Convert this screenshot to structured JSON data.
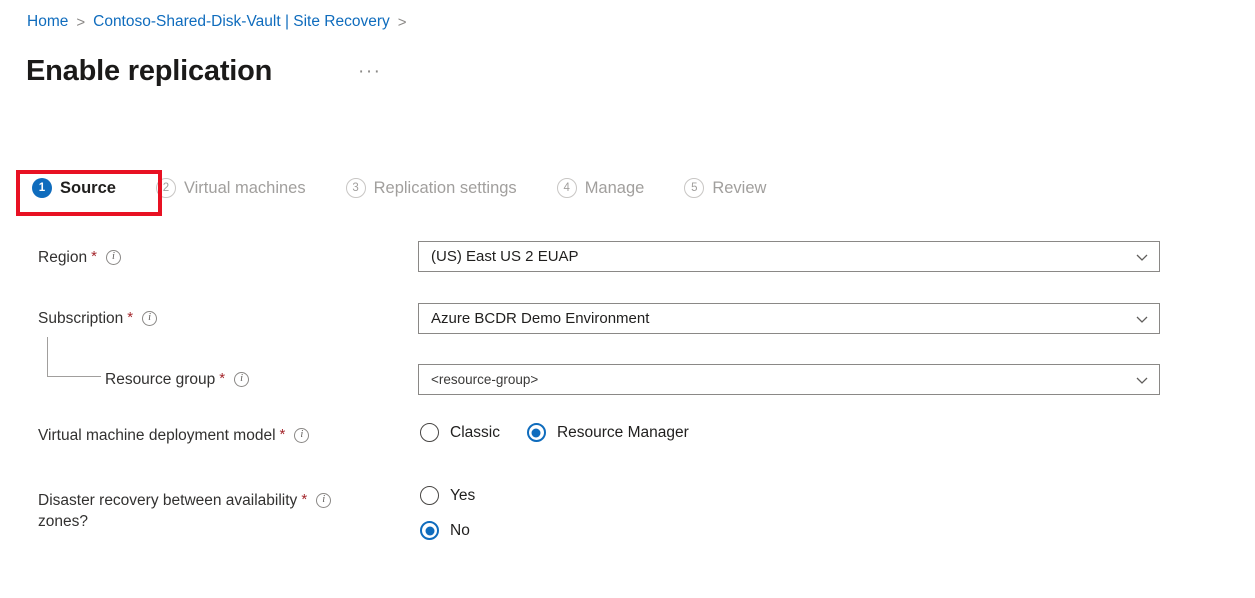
{
  "breadcrumb": {
    "items": [
      {
        "label": "Home",
        "separator": ">"
      },
      {
        "label": "Contoso-Shared-Disk-Vault | Site Recovery",
        "separator": ">"
      }
    ],
    "sep0": ">",
    "sep1": ">"
  },
  "header": {
    "title": "Enable replication",
    "more_label": "···"
  },
  "steps": [
    {
      "number": "1",
      "label": "Source",
      "state": "active"
    },
    {
      "number": "2",
      "label": "Virtual machines",
      "state": "inactive"
    },
    {
      "number": "3",
      "label": "Replication settings",
      "state": "inactive"
    },
    {
      "number": "4",
      "label": "Manage",
      "state": "inactive"
    },
    {
      "number": "5",
      "label": "Review",
      "state": "inactive"
    }
  ],
  "form": {
    "region": {
      "label": "Region",
      "required_marker": "*",
      "value": "(US) East US 2 EUAP"
    },
    "subscription": {
      "label": "Subscription",
      "required_marker": "*",
      "value": "Azure BCDR Demo Environment"
    },
    "resource_group": {
      "label": "Resource group",
      "required_marker": "*",
      "value": "<resource-group>"
    },
    "deployment_model": {
      "label": "Virtual machine deployment model",
      "required_marker": "*",
      "options": [
        {
          "label": "Classic",
          "selected": false
        },
        {
          "label": "Resource Manager",
          "selected": true
        }
      ]
    },
    "availability_zones": {
      "label": "Disaster recovery between availability\nzones?",
      "required_marker": "*",
      "options": [
        {
          "label": "Yes",
          "selected": false
        },
        {
          "label": "No",
          "selected": true
        }
      ]
    }
  },
  "colors": {
    "accent": "#0f6cbd",
    "link": "#0f6cbd",
    "required": "#a4262c",
    "annotation": "#e81123",
    "border": "#8a8886",
    "disabled_text": "#a19f9d"
  }
}
